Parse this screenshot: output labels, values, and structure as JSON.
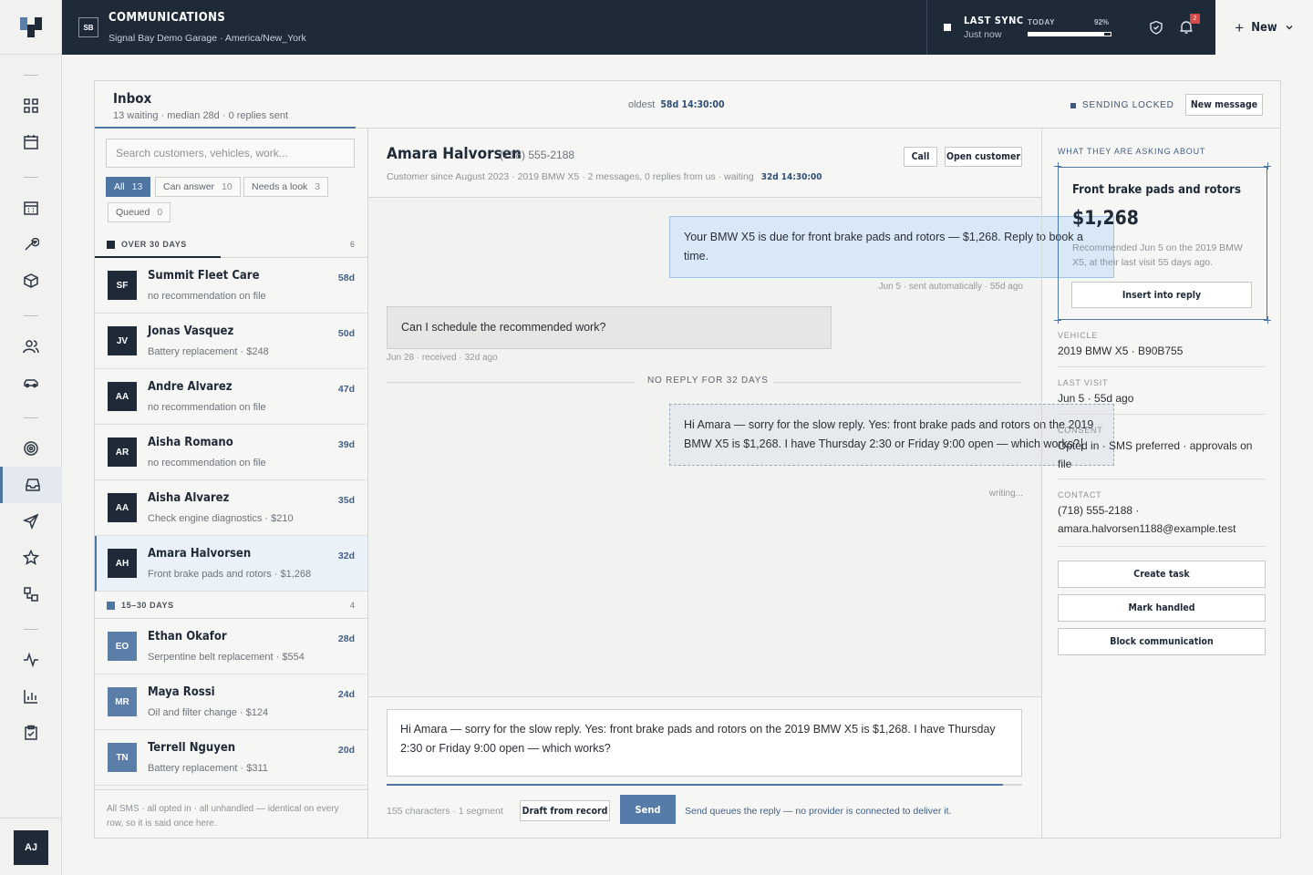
{
  "app": {
    "badge": "SB",
    "title": "COMMUNICATIONS",
    "subtitle": "Signal Bay Demo Garage · America/New_York"
  },
  "sync": {
    "label": "LAST SYNC",
    "sub": "Just now",
    "period": "TODAY",
    "percent_label": "92%",
    "percent": 0.92,
    "notifications": "2"
  },
  "new_button": "New",
  "user_initials": "AJ",
  "rail_icons": [
    "grid-icon",
    "calendar-icon",
    "calendar-grid-icon",
    "wrench-icon",
    "box-icon",
    "users-icon",
    "car-icon",
    "target-icon",
    "inbox-icon",
    "send-icon",
    "star-icon",
    "flow-icon",
    "activity-icon",
    "bar-chart-icon",
    "clipboard-icon"
  ],
  "inbox": {
    "title": "Inbox",
    "stats": "13 waiting · median 28d · 0 replies sent",
    "oldest_label": "oldest",
    "oldest_value": "58d 14:30:00",
    "locked_label": "SENDING LOCKED",
    "new_message": "New message"
  },
  "list": {
    "search_placeholder": "Search customers, vehicles, work...",
    "filters": [
      {
        "label": "All",
        "count": "13"
      },
      {
        "label": "Can answer",
        "count": "10"
      },
      {
        "label": "Needs a look",
        "count": "3"
      },
      {
        "label": "Queued",
        "count": "0"
      }
    ],
    "groups": [
      {
        "label": "OVER 30 DAYS",
        "count": "6",
        "color": "#1f2a39"
      },
      {
        "label": "15–30 DAYS",
        "count": "4",
        "color": "#4f76a3"
      }
    ],
    "rows": [
      {
        "initials": "SF",
        "name": "Summit Fleet Care",
        "desc": "no recommendation on file",
        "age": "58d"
      },
      {
        "initials": "JV",
        "name": "Jonas Vasquez",
        "desc": "Battery replacement · $248",
        "age": "50d"
      },
      {
        "initials": "AA",
        "name": "Andre Alvarez",
        "desc": "no recommendation on file",
        "age": "47d"
      },
      {
        "initials": "AR",
        "name": "Aisha Romano",
        "desc": "no recommendation on file",
        "age": "39d"
      },
      {
        "initials": "AA",
        "name": "Aisha Alvarez",
        "desc": "Check engine diagnostics · $210",
        "age": "35d"
      },
      {
        "initials": "AH",
        "name": "Amara Halvorsen",
        "desc": "Front brake pads and rotors · $1,268",
        "age": "32d"
      },
      {
        "initials": "EO",
        "name": "Ethan Okafor",
        "desc": "Serpentine belt replacement · $554",
        "age": "28d"
      },
      {
        "initials": "MR",
        "name": "Maya Rossi",
        "desc": "Oil and filter change · $124",
        "age": "24d"
      },
      {
        "initials": "TN",
        "name": "Terrell Nguyen",
        "desc": "Battery replacement · $311",
        "age": "20d"
      }
    ],
    "footer": "All SMS · all opted in · all unhandled — identical on every row, so it is said once here."
  },
  "thread": {
    "name": "Amara Halvorsen",
    "phone": "(718) 555-2188",
    "meta": "Customer since August 2023 · 2019 BMW X5 · 2 messages, 0 replies from us  ·  waiting",
    "waiting": "32d 14:30:00",
    "call": "Call",
    "open_customer": "Open customer",
    "msg_out": "Your BMW X5 is due for front brake pads and rotors — $1,268. Reply to book a time.",
    "msg_out_meta": "Jun 5 · sent automatically · 55d ago",
    "msg_in": "Can I schedule the recommended work?",
    "msg_in_meta": "Jun 28 · received · 32d ago",
    "gap_label": "NO REPLY FOR 32 DAYS",
    "draft": "Hi Amara — sorry for the slow reply. Yes: front brake pads and rotors on the 2019 BMW X5 is $1,268. I have Thursday 2:30 or Friday 9:00 open — which works?",
    "draft_meta": "writing..."
  },
  "composer": {
    "text": "Hi Amara — sorry for the slow reply. Yes: front brake pads and rotors on the 2019 BMW X5 is $1,268. I have Thursday 2:30 or Friday 9:00 open — which works?",
    "chars": "155 characters · 1 segment",
    "fill": 0.97,
    "draft_button": "Draft from record",
    "send": "Send",
    "note": "Send queues the reply — no provider is connected to deliver it."
  },
  "side": {
    "asking_label": "WHAT THEY ARE ASKING ABOUT",
    "card_title": "Front brake pads and rotors",
    "card_price": "$1,268",
    "card_rec": "Recommended Jun 5 on the 2019 BMW X5, at their last visit 55 days ago.",
    "insert": "Insert into reply",
    "vehicle_label": "VEHICLE",
    "vehicle": "2019 BMW X5 · B90B755",
    "visit_label": "LAST VISIT",
    "visit": "Jun 5 · 55d ago",
    "consent_label": "CONSENT",
    "consent": "Opted in · SMS preferred · approvals on file",
    "contact_label": "CONTACT",
    "contact_phone": "(718) 555-2188 ·",
    "contact_email": "amara.halvorsen1188@example.test",
    "create_task": "Create task",
    "mark_handled": "Mark handled",
    "block": "Block communication"
  }
}
